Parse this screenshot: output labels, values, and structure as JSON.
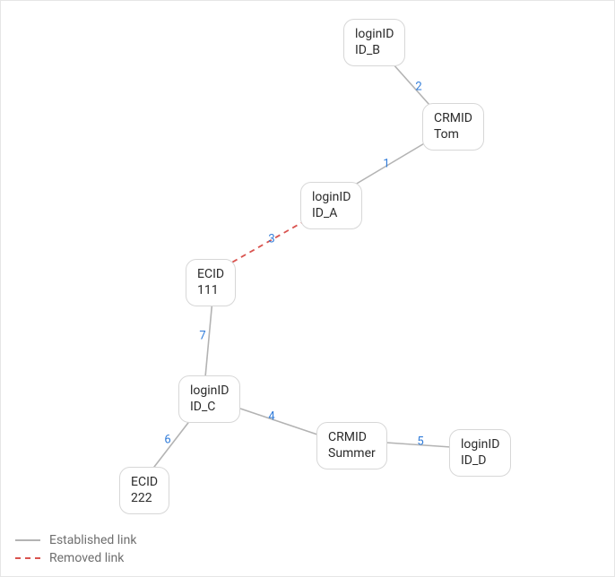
{
  "nodes": {
    "n_loginid_b": {
      "type": "loginID",
      "value": "ID_B"
    },
    "n_crmid_tom": {
      "type": "CRMID",
      "value": "Tom"
    },
    "n_loginid_a": {
      "type": "loginID",
      "value": "ID_A"
    },
    "n_ecid_111": {
      "type": "ECID",
      "value": "111"
    },
    "n_loginid_c": {
      "type": "loginID",
      "value": "ID_C"
    },
    "n_ecid_222": {
      "type": "ECID",
      "value": "222"
    },
    "n_crmid_summer": {
      "type": "CRMID",
      "value": "Summer"
    },
    "n_loginid_d": {
      "type": "loginID",
      "value": "ID_D"
    }
  },
  "edges": {
    "e1": {
      "from": "n_crmid_tom",
      "to": "n_loginid_a",
      "label": "1",
      "kind": "established"
    },
    "e2": {
      "from": "n_loginid_b",
      "to": "n_crmid_tom",
      "label": "2",
      "kind": "established"
    },
    "e3": {
      "from": "n_loginid_a",
      "to": "n_ecid_111",
      "label": "3",
      "kind": "removed"
    },
    "e4": {
      "from": "n_loginid_c",
      "to": "n_crmid_summer",
      "label": "4",
      "kind": "established"
    },
    "e5": {
      "from": "n_crmid_summer",
      "to": "n_loginid_d",
      "label": "5",
      "kind": "established"
    },
    "e6": {
      "from": "n_loginid_c",
      "to": "n_ecid_222",
      "label": "6",
      "kind": "established"
    },
    "e7": {
      "from": "n_ecid_111",
      "to": "n_loginid_c",
      "label": "7",
      "kind": "established"
    }
  },
  "legend": {
    "established": "Established link",
    "removed": "Removed link"
  },
  "colors": {
    "edge_established": "#b3b3b3",
    "edge_removed": "#d9534f",
    "edge_label": "#2f7bd9",
    "node_border": "#d7d7d7"
  }
}
